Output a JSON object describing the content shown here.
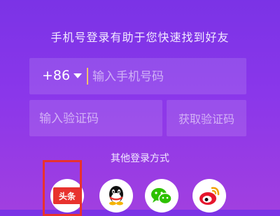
{
  "header": {
    "text": "手机号登录有助于您快速找到好友"
  },
  "phone": {
    "country_code": "+86",
    "placeholder": "输入手机号码"
  },
  "verification": {
    "placeholder": "输入验证码",
    "button_label": "获取验证码"
  },
  "other_login": {
    "label": "其他登录方式",
    "options": [
      {
        "icon": "toutiao-icon",
        "text": "头条",
        "color": "#e8322e"
      },
      {
        "icon": "qq-icon"
      },
      {
        "icon": "wechat-icon",
        "color": "#2dc100"
      },
      {
        "icon": "weibo-icon",
        "color": "#e6162d"
      }
    ]
  },
  "colors": {
    "background_top": "#7b33e6",
    "background_bottom": "#a13fe0",
    "highlight": "#e8322e",
    "cursor": "#f0c36a"
  }
}
